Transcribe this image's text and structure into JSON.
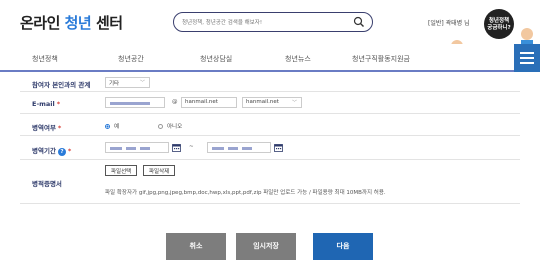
{
  "header": {
    "logo_prefix": "온라인 ",
    "logo_accent": "청년",
    "logo_suffix": " 센터",
    "search_placeholder": "청년정책, 청년공간 검색을 해보자!",
    "user": "[일반] 곽태병 님",
    "promo_line1": "청년정책",
    "promo_line2": "궁금하니?"
  },
  "nav": {
    "items": [
      "청년정책",
      "청년공간",
      "청년상담실",
      "청년뉴스",
      "청년구직활동지원금"
    ]
  },
  "form": {
    "relation": {
      "label": "참여자 본인과의 관계",
      "value": "기타"
    },
    "email": {
      "label": "E-mail",
      "at": "@",
      "domain_value": "hanmail.net",
      "domain_select": "hanmail.net"
    },
    "military": {
      "label": "병역여부",
      "options": [
        "예",
        "아니오"
      ],
      "selected": "예"
    },
    "period": {
      "label": "병역기간",
      "separator": "~"
    },
    "certificate": {
      "label": "병적증명서",
      "select_file": "파일선택",
      "delete_file": "파일삭제",
      "note": "파일 확장자가 gif,jpg,png,jpeg,bmp,doc,hwp,xls,ppt,pdf,zip 파일만 업로드 가능 / 파일용량 최대 10MB까지 허용."
    }
  },
  "buttons": {
    "cancel": "취소",
    "save_temp": "임시저장",
    "next": "다음"
  },
  "colors": {
    "accent": "#2a7bd9",
    "nav_border": "#6a7cc4",
    "button_gray": "#7d7d7d",
    "button_blue": "#1f66b3"
  }
}
